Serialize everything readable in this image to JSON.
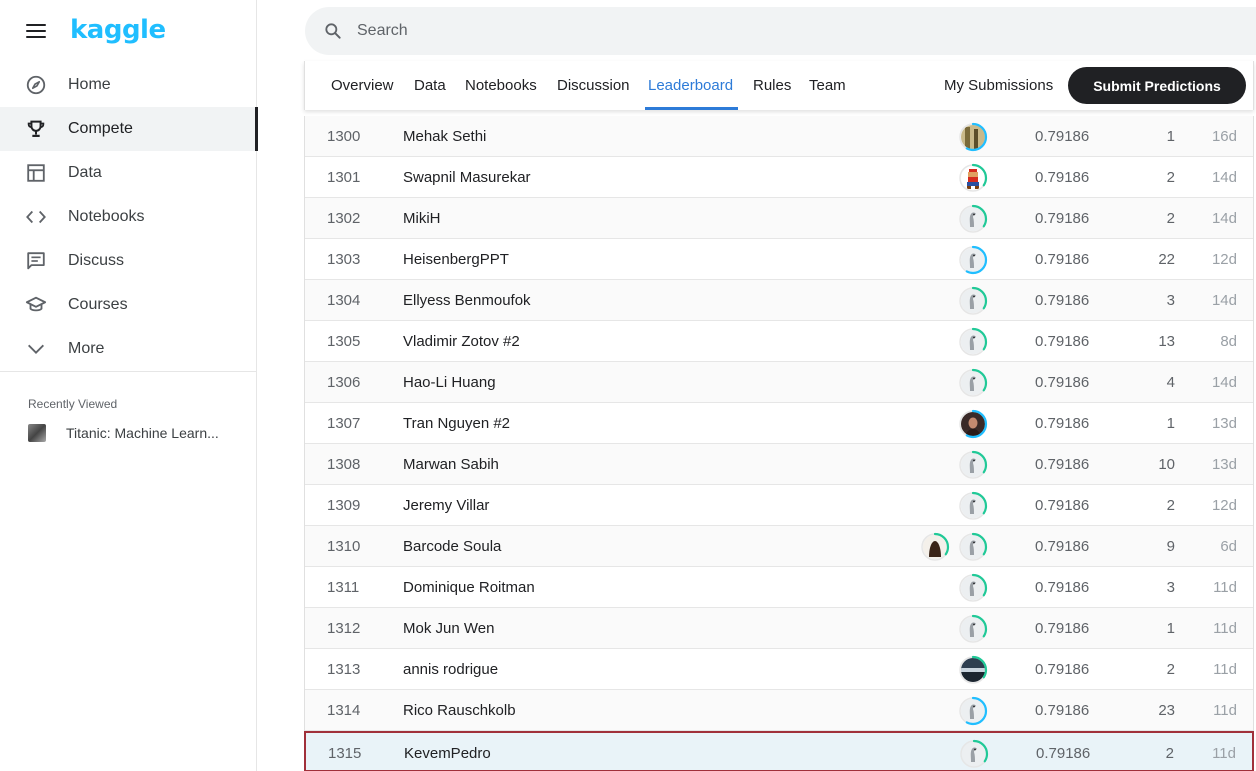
{
  "app": {
    "logo": "kaggle"
  },
  "sidebar": {
    "items": [
      {
        "label": "Home",
        "icon": "compass-icon",
        "active": false
      },
      {
        "label": "Compete",
        "icon": "trophy-icon",
        "active": true
      },
      {
        "label": "Data",
        "icon": "table-icon",
        "active": false
      },
      {
        "label": "Notebooks",
        "icon": "code-icon",
        "active": false
      },
      {
        "label": "Discuss",
        "icon": "comment-icon",
        "active": false
      },
      {
        "label": "Courses",
        "icon": "graduation-cap-icon",
        "active": false
      },
      {
        "label": "More",
        "icon": "chevron-down-icon",
        "active": false
      }
    ],
    "recent_title": "Recently Viewed",
    "recent_items": [
      {
        "label": "Titanic: Machine Learn..."
      }
    ]
  },
  "search": {
    "placeholder": "Search",
    "value": ""
  },
  "tabs": [
    {
      "label": "Overview",
      "active": false
    },
    {
      "label": "Data",
      "active": false
    },
    {
      "label": "Notebooks",
      "active": false
    },
    {
      "label": "Discussion",
      "active": false
    },
    {
      "label": "Leaderboard",
      "active": true
    },
    {
      "label": "Rules",
      "active": false
    },
    {
      "label": "Team",
      "active": false
    }
  ],
  "actions": {
    "my_submissions": "My Submissions",
    "submit": "Submit Predictions"
  },
  "colors": {
    "accent": "#20beff",
    "tab_active": "#2d7bd8",
    "highlight_bg": "#e9f3f8",
    "highlight_border": "#a0303a",
    "ring_green": "#20c997",
    "ring_blue": "#20beff"
  },
  "leaderboard": {
    "rows": [
      {
        "rank": "1300",
        "name": "Mehak Sethi",
        "score": "0.79186",
        "entries": "1",
        "last": "16d",
        "avatars": [
          "photo-tan"
        ],
        "ring": "blue"
      },
      {
        "rank": "1301",
        "name": "Swapnil Masurekar",
        "score": "0.79186",
        "entries": "2",
        "last": "14d",
        "avatars": [
          "mario"
        ],
        "ring": "green"
      },
      {
        "rank": "1302",
        "name": "MikiH",
        "score": "0.79186",
        "entries": "2",
        "last": "14d",
        "avatars": [
          "default"
        ],
        "ring": "green"
      },
      {
        "rank": "1303",
        "name": "HeisenbergPPT",
        "score": "0.79186",
        "entries": "22",
        "last": "12d",
        "avatars": [
          "default"
        ],
        "ring": "blue"
      },
      {
        "rank": "1304",
        "name": "Ellyess Benmoufok",
        "score": "0.79186",
        "entries": "3",
        "last": "14d",
        "avatars": [
          "default"
        ],
        "ring": "green"
      },
      {
        "rank": "1305",
        "name": "Vladimir Zotov #2",
        "score": "0.79186",
        "entries": "13",
        "last": "8d",
        "avatars": [
          "default"
        ],
        "ring": "green"
      },
      {
        "rank": "1306",
        "name": "Hao-Li Huang",
        "score": "0.79186",
        "entries": "4",
        "last": "14d",
        "avatars": [
          "default"
        ],
        "ring": "green"
      },
      {
        "rank": "1307",
        "name": "Tran Nguyen #2",
        "score": "0.79186",
        "entries": "1",
        "last": "13d",
        "avatars": [
          "photo-dark"
        ],
        "ring": "blue"
      },
      {
        "rank": "1308",
        "name": "Marwan Sabih",
        "score": "0.79186",
        "entries": "10",
        "last": "13d",
        "avatars": [
          "default"
        ],
        "ring": "green"
      },
      {
        "rank": "1309",
        "name": "Jeremy Villar",
        "score": "0.79186",
        "entries": "2",
        "last": "12d",
        "avatars": [
          "default"
        ],
        "ring": "green"
      },
      {
        "rank": "1310",
        "name": "Barcode Soula",
        "score": "0.79186",
        "entries": "9",
        "last": "6d",
        "avatars": [
          "photo-brown",
          "default"
        ],
        "ring": "green"
      },
      {
        "rank": "1311",
        "name": "Dominique Roitman",
        "score": "0.79186",
        "entries": "3",
        "last": "11d",
        "avatars": [
          "default"
        ],
        "ring": "green"
      },
      {
        "rank": "1312",
        "name": "Mok Jun Wen",
        "score": "0.79186",
        "entries": "1",
        "last": "11d",
        "avatars": [
          "default"
        ],
        "ring": "green"
      },
      {
        "rank": "1313",
        "name": "annis rodrigue",
        "score": "0.79186",
        "entries": "2",
        "last": "11d",
        "avatars": [
          "photo-sky"
        ],
        "ring": "green"
      },
      {
        "rank": "1314",
        "name": "Rico Rauschkolb",
        "score": "0.79186",
        "entries": "23",
        "last": "11d",
        "avatars": [
          "default"
        ],
        "ring": "blue"
      },
      {
        "rank": "1315",
        "name": "KevemPedro",
        "score": "0.79186",
        "entries": "2",
        "last": "11d",
        "avatars": [
          "default"
        ],
        "ring": "green",
        "highlight": true
      }
    ]
  }
}
